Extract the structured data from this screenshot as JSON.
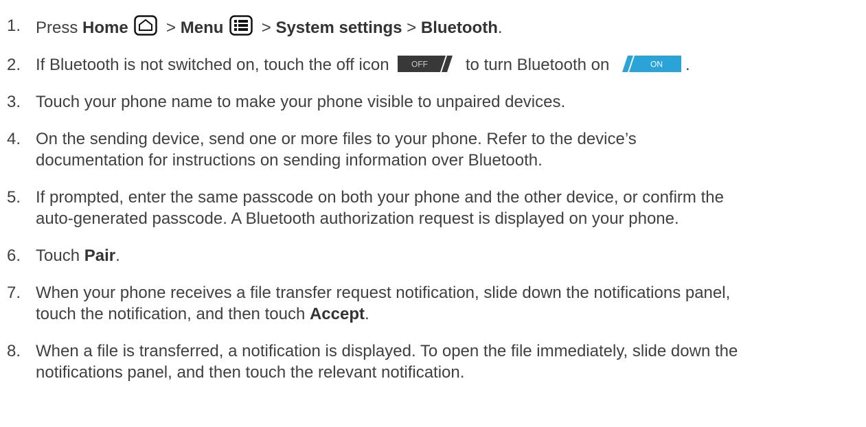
{
  "steps": [
    {
      "num": "1.",
      "t1": "Press ",
      "home": "Home",
      "sep1": " > ",
      "menu": "Menu",
      "sep2": " > ",
      "settings": "System settings",
      "sep3": " > ",
      "bluetooth": "Bluetooth",
      "end": "."
    },
    {
      "num": "2.",
      "t1": "If Bluetooth is not switched on, touch the off icon",
      "off_label": "OFF",
      "t2": "to turn Bluetooth on",
      "on_label": "ON",
      "end": "."
    },
    {
      "num": "3.",
      "text": "Touch your phone name to make your phone visible to unpaired devices."
    },
    {
      "num": "4.",
      "line1": "On the sending device, send one or more files to your phone. Refer to the device’s",
      "line2": "documentation for instructions on sending information over Bluetooth."
    },
    {
      "num": "5.",
      "line1": "If prompted, enter the same passcode on both your phone and the other device, or confirm the",
      "line2": "auto-generated passcode. A Bluetooth authorization request is displayed on your phone."
    },
    {
      "num": "6.",
      "t1": "Touch ",
      "pair": "Pair",
      "end": "."
    },
    {
      "num": "7.",
      "line1": "When your phone receives a file transfer request notification, slide down the notifications panel,",
      "line2a": "touch the notification, and then touch ",
      "accept": "Accept",
      "end": "."
    },
    {
      "num": "8.",
      "line1": "When a file is transferred, a notification is displayed. To open the file immediately, slide down the",
      "line2": "notifications panel, and then touch the relevant notification."
    }
  ],
  "colors": {
    "text": "#404040",
    "toggle_off": "#333333",
    "toggle_on": "#2aa3d8"
  }
}
